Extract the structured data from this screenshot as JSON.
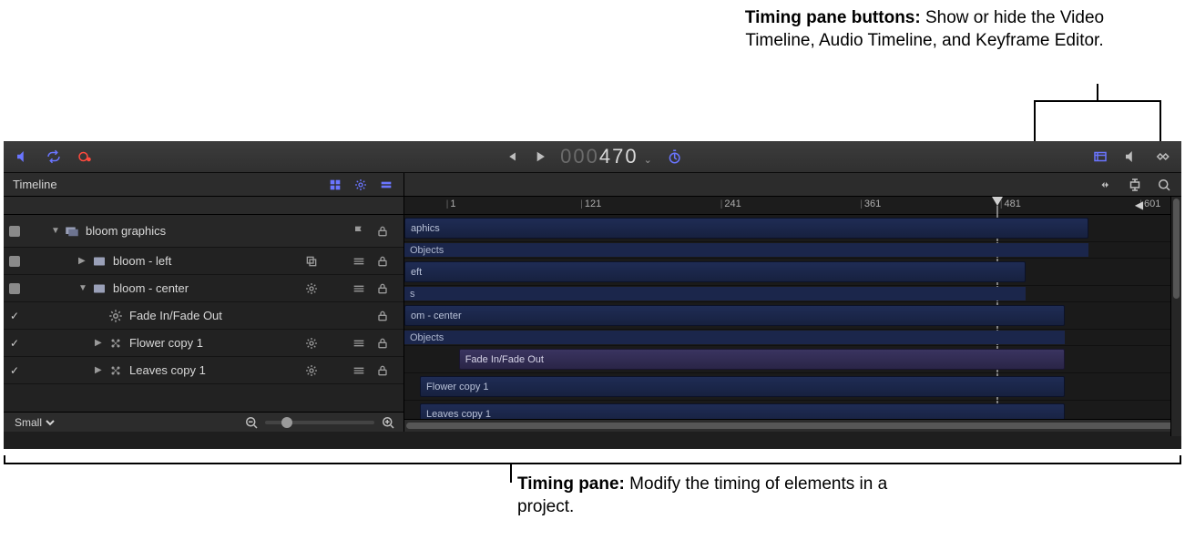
{
  "callouts": {
    "top": {
      "bold": "Timing pane buttons:",
      "text": " Show or hide the Video Timeline, Audio Timeline, and Keyframe Editor."
    },
    "bottom": {
      "bold": "Timing pane:",
      "text": " Modify the timing of elements in a project."
    }
  },
  "topbar": {
    "timecode_dim": "000",
    "timecode_main": "470"
  },
  "panel": {
    "title": "Timeline"
  },
  "ruler": {
    "marks": [
      {
        "label": "1",
        "pct": 6
      },
      {
        "label": "121",
        "pct": 24
      },
      {
        "label": "241",
        "pct": 42
      },
      {
        "label": "361",
        "pct": 60
      },
      {
        "label": "481",
        "pct": 78
      },
      {
        "label": "601",
        "pct": 96
      }
    ],
    "playhead_pct": 76.3,
    "end_pct": 94.0
  },
  "layers": [
    {
      "id": "g0",
      "type": "group",
      "name": "bloom graphics",
      "expanded": true,
      "enabled": true,
      "indent": 1,
      "clip": {
        "label": "aphics",
        "start": 0,
        "end": 88
      },
      "subline": {
        "label": "Objects",
        "start": 0,
        "end": 88
      }
    },
    {
      "id": "l1",
      "type": "layer",
      "name": "bloom - left",
      "expanded": false,
      "enabled": true,
      "indent": 2,
      "clip": {
        "label": "eft",
        "start": 0,
        "end": 80
      },
      "subline": {
        "label": "s",
        "start": 0,
        "end": 80
      }
    },
    {
      "id": "l2",
      "type": "layer",
      "name": "bloom - center",
      "expanded": true,
      "enabled": true,
      "hasGear": true,
      "indent": 2,
      "clip": {
        "label": "om - center",
        "start": 0,
        "end": 85
      },
      "subline": {
        "label": "Objects",
        "start": 0,
        "end": 85
      }
    },
    {
      "id": "b3",
      "type": "behavior",
      "name": "Fade In/Fade Out",
      "enabled": true,
      "indent": 3,
      "clip": {
        "label": "Fade In/Fade Out",
        "start": 7,
        "end": 85
      }
    },
    {
      "id": "l4",
      "type": "layer",
      "name": "Flower copy 1",
      "expanded": false,
      "enabled": true,
      "hasGear": true,
      "indent": 3,
      "clip": {
        "label": "Flower copy 1",
        "start": 2,
        "end": 85
      }
    },
    {
      "id": "l5",
      "type": "layer",
      "name": "Leaves copy 1",
      "expanded": false,
      "enabled": true,
      "hasGear": true,
      "indent": 3,
      "clip": {
        "label": "Leaves copy 1",
        "start": 2,
        "end": 85
      }
    }
  ],
  "footer": {
    "size_option": "Small"
  }
}
